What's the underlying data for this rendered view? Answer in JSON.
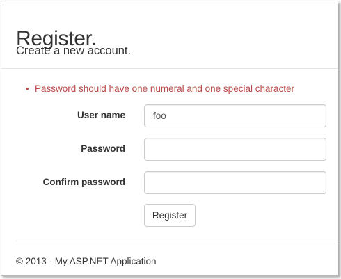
{
  "page": {
    "title": "Register.",
    "subtitle": "Create a new account."
  },
  "validation": {
    "errors": [
      "Password should have one numeral and one special character"
    ],
    "color": "#b94a48"
  },
  "form": {
    "username": {
      "label": "User name",
      "value": "foo"
    },
    "password": {
      "label": "Password",
      "value": ""
    },
    "confirm_password": {
      "label": "Confirm password",
      "value": ""
    },
    "submit_label": "Register"
  },
  "footer": {
    "text": "© 2013 - My ASP.NET Application"
  }
}
